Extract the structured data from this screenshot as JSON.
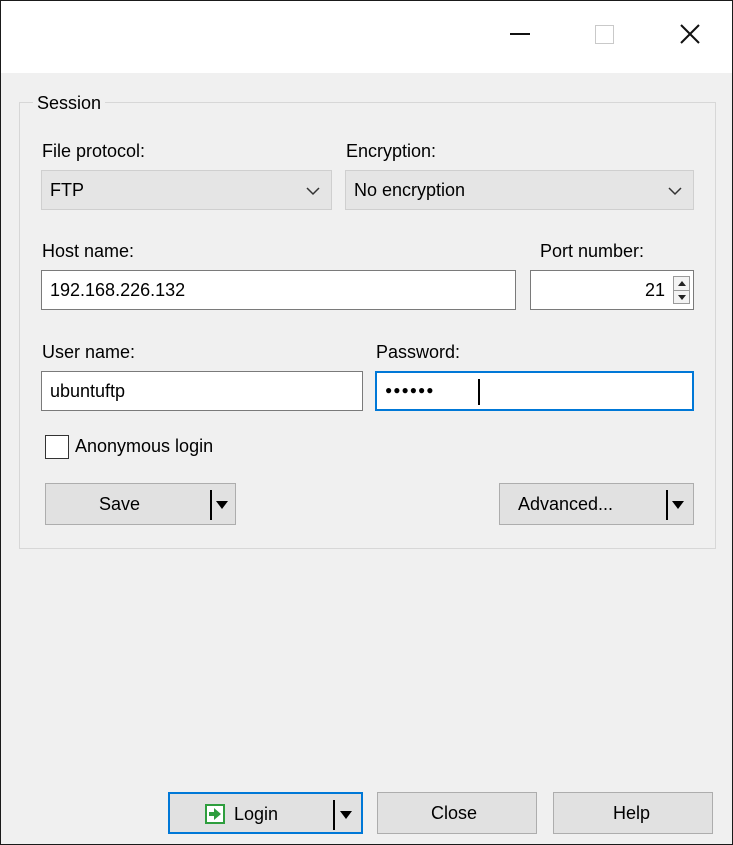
{
  "titlebar": {
    "minimize": "minimize",
    "maximize": "maximize",
    "close": "close"
  },
  "session": {
    "group_label": "Session",
    "file_protocol": {
      "label": "File protocol:",
      "value": "FTP"
    },
    "encryption": {
      "label": "Encryption:",
      "value": "No encryption"
    },
    "host_name": {
      "label": "Host name:",
      "value": "192.168.226.132"
    },
    "port_number": {
      "label": "Port number:",
      "value": "21"
    },
    "user_name": {
      "label": "User name:",
      "value": "ubuntuftp"
    },
    "password": {
      "label": "Password:",
      "masked_value": "●●●●●●"
    },
    "anonymous_login": {
      "label": "Anonymous login",
      "checked": false
    },
    "save_button": "Save",
    "advanced_button": "Advanced..."
  },
  "footer": {
    "login_button": "Login",
    "close_button": "Close",
    "help_button": "Help"
  },
  "colors": {
    "accent": "#0078d7",
    "login_icon": "#2e9e3e"
  },
  "icons": [
    "minimize-icon",
    "maximize-icon",
    "close-icon",
    "chevron-down-icon",
    "spin-up-icon",
    "spin-down-icon",
    "login-icon",
    "dropdown-arrow-icon"
  ]
}
